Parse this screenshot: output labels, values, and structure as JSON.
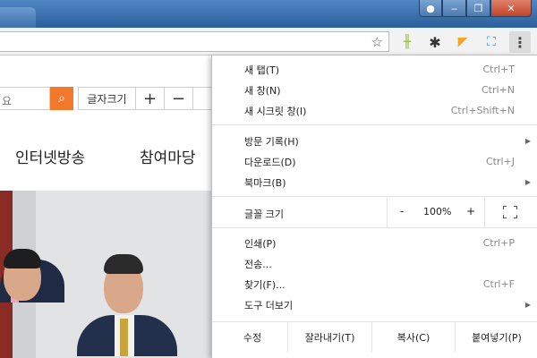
{
  "window": {
    "user_label": "●",
    "min_label": "‒",
    "max_label": "❐",
    "close_label": "✕"
  },
  "toolbar": {
    "star_icon": "star-icon",
    "star_glyph": "☆",
    "kebab_glyph": "⋮",
    "gear_glyph": "✱",
    "ladder_glyph": "╫",
    "flag_glyph": "◤",
    "frame_glyph": "⛶"
  },
  "page": {
    "search_partial": "요",
    "search_glyph": "🔍",
    "font_size_label": "글자크기",
    "plus": "+",
    "minus": "−",
    "nav": [
      "인터넷방송",
      "참여마당"
    ]
  },
  "menu": {
    "items_top": [
      {
        "label": "새 탭(T)",
        "shortcut": "Ctrl+T"
      },
      {
        "label": "새 창(N)",
        "shortcut": "Ctrl+N"
      },
      {
        "label": "새 시크릿 창(I)",
        "shortcut": "Ctrl+Shift+N"
      }
    ],
    "items_mid": [
      {
        "label": "방문 기록(H)",
        "shortcut": ""
      },
      {
        "label": "다운로드(D)",
        "shortcut": "Ctrl+J"
      },
      {
        "label": "북마크(B)",
        "shortcut": ""
      }
    ],
    "zoom": {
      "label": "글꼴 크기",
      "minus": "-",
      "value": "100%",
      "plus": "+"
    },
    "items_low": [
      {
        "label": "인쇄(P)",
        "shortcut": "Ctrl+P"
      },
      {
        "label": "전송...",
        "shortcut": ""
      },
      {
        "label": "찾기(F)...",
        "shortcut": "Ctrl+F"
      },
      {
        "label": "도구 더보기",
        "shortcut": ""
      }
    ],
    "edit": {
      "label": "수정",
      "cut": "잘라내기(T)",
      "copy": "복사(C)",
      "paste": "붙여넣기(P)"
    },
    "submenu_arrow": "▶"
  }
}
